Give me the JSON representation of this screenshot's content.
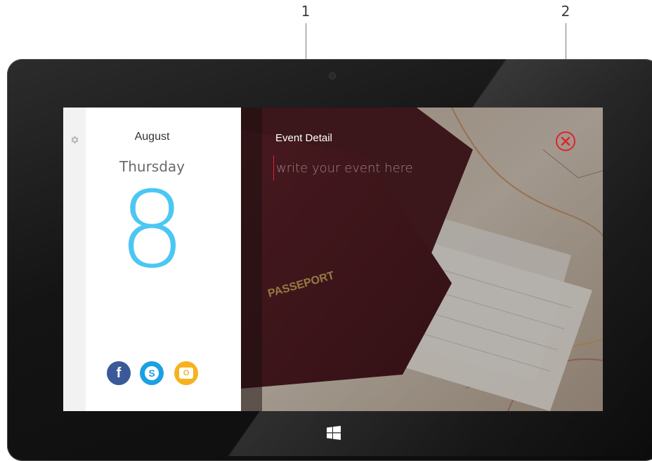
{
  "callouts": [
    {
      "number": "1"
    },
    {
      "number": "2"
    }
  ],
  "calendar": {
    "month": "August",
    "weekday": "Thursday",
    "day": "8"
  },
  "event": {
    "label": "Event Detail",
    "placeholder": "write your event here",
    "value": ""
  },
  "photo": {
    "passport_text": "PASSEPORT"
  },
  "icons": {
    "settings": "gear-icon",
    "close": "close-icon",
    "facebook": {
      "icon": "facebook-icon",
      "glyph": "f",
      "color": "#3b5998"
    },
    "skype": {
      "icon": "skype-icon",
      "glyph": "S",
      "color": "#1ba1e2"
    },
    "outlook": {
      "icon": "outlook-icon",
      "glyph": "O",
      "color": "#f6b21d"
    },
    "windows": "windows-logo-icon"
  },
  "colors": {
    "accent_day": "#4cc7f3",
    "close_red": "#e0242c"
  }
}
